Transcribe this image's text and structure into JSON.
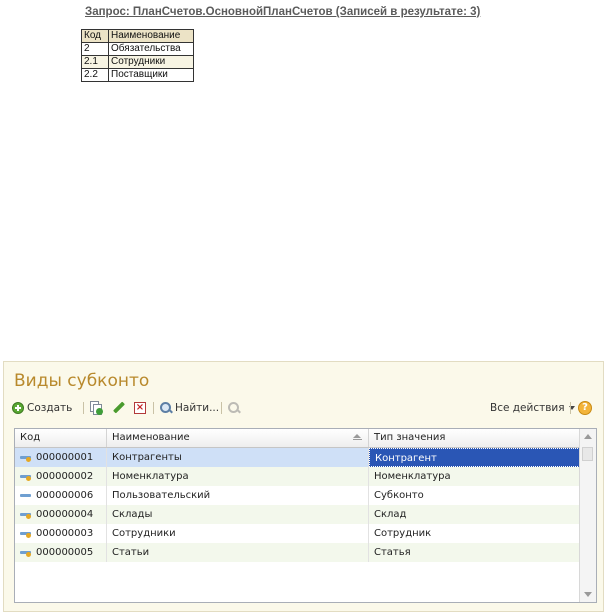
{
  "report": {
    "title": "Запрос: ПланСчетов.ОсновнойПланСчетов (Записей в результате: 3)",
    "columns": [
      "Код",
      "Наименование"
    ],
    "rows": [
      [
        "2",
        "Обязательства"
      ],
      [
        "2.1",
        "Сотрудники"
      ],
      [
        "2.2",
        "Поставщики"
      ]
    ]
  },
  "form": {
    "title": "Виды субконто",
    "toolbar": {
      "create_label": "Создать",
      "find_label": "Найти...",
      "all_actions_label": "Все действия",
      "help_label": "?"
    },
    "grid": {
      "columns": [
        "Код",
        "Наименование",
        "Тип значения"
      ],
      "rows": [
        {
          "code": "000000001",
          "name": "Контрагенты",
          "type": "Контрагент",
          "icon": "item-with-subordinate-icon"
        },
        {
          "code": "000000002",
          "name": "Номенклатура",
          "type": "Номенклатура",
          "icon": "item-with-subordinate-icon"
        },
        {
          "code": "000000006",
          "name": "Пользовательский",
          "type": "Субконто",
          "icon": "item-icon"
        },
        {
          "code": "000000004",
          "name": "Склады",
          "type": "Склад",
          "icon": "item-with-subordinate-icon"
        },
        {
          "code": "000000003",
          "name": "Сотрудники",
          "type": "Сотрудник",
          "icon": "item-with-subordinate-icon"
        },
        {
          "code": "000000005",
          "name": "Статьи",
          "type": "Статья",
          "icon": "item-with-subordinate-icon"
        }
      ]
    }
  },
  "colors": {
    "form_background": "#fbf9ea",
    "title_accent": "#b8892c",
    "selected_row": "#cfe0f7",
    "selected_cell": "#2a56b5",
    "alternate_row": "#f3f8ec"
  }
}
